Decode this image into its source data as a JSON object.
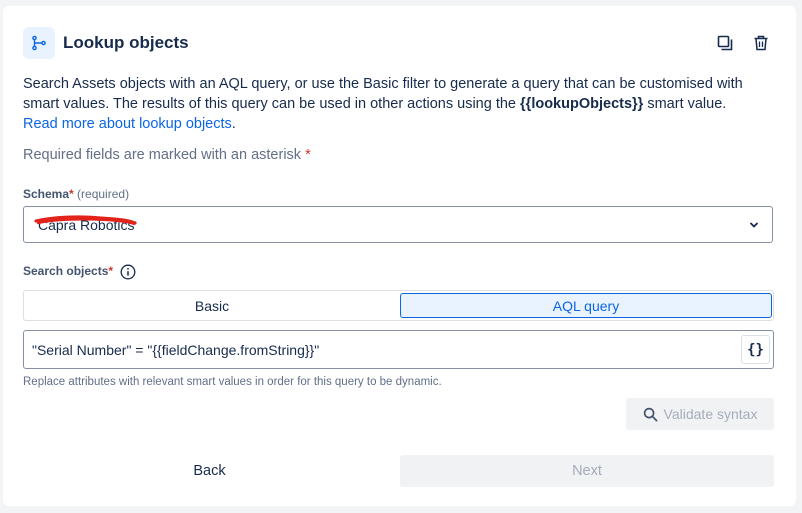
{
  "header": {
    "title": "Lookup objects",
    "icon": "branch-icon",
    "actions": [
      "duplicate-icon",
      "trash-icon"
    ]
  },
  "description": {
    "text_before": "Search Assets objects with an AQL query, or use the Basic filter to generate a query that can be customised with smart values. The results of this query can be used in other actions using the ",
    "smart_value": "{{lookupObjects}}",
    "text_after": " smart value.",
    "link": "Read more about lookup objects",
    "link_suffix": "."
  },
  "required_note": "Required fields are marked with an asterisk",
  "asterisk": "*",
  "schema": {
    "label": "Schema",
    "required_hint": "(required)",
    "value": "Capra Robotics"
  },
  "search_objects": {
    "label": "Search objects",
    "tabs": {
      "basic": "Basic",
      "aql": "AQL query",
      "active": "aql"
    },
    "query": "\"Serial Number\" = \"{{fieldChange.fromString}}\"",
    "braces": "{}",
    "helper": "Replace attributes with relevant smart values in order for this query to be dynamic."
  },
  "validate_label": "Validate syntax",
  "footer": {
    "back": "Back",
    "next": "Next"
  },
  "colors": {
    "accent": "#0c66e4",
    "required": "#c9372c",
    "redaction": "#e2231a"
  }
}
